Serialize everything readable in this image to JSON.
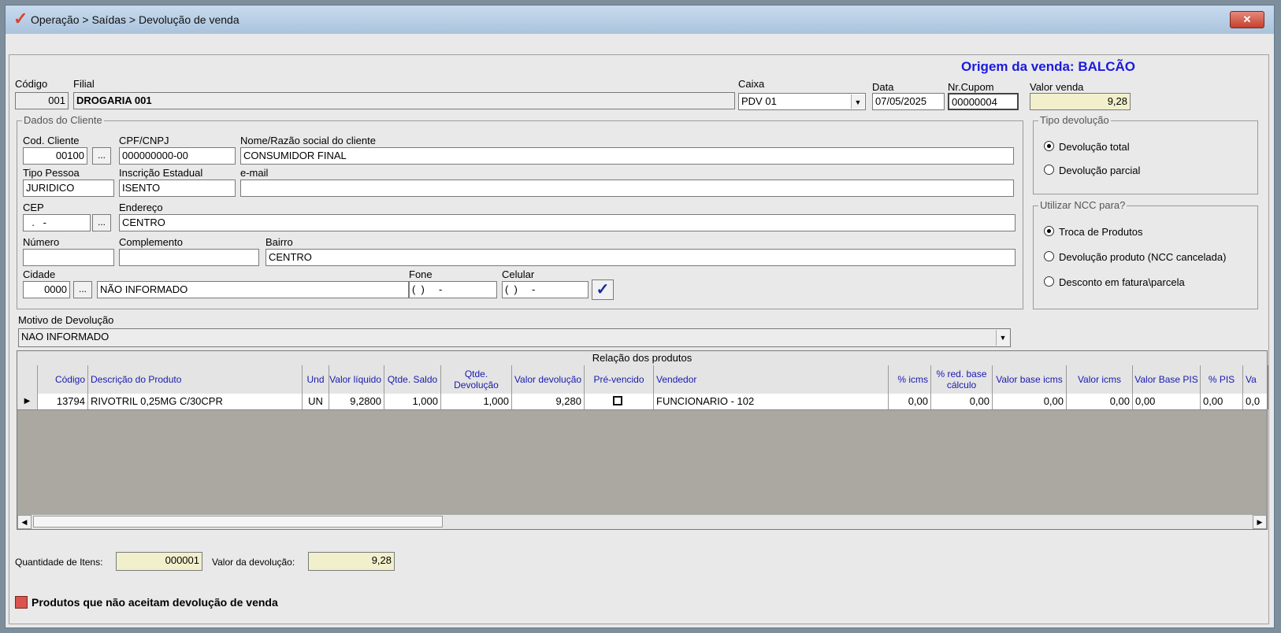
{
  "window": {
    "title": "Operação > Saídas > Devolução de venda",
    "close_label": "✕"
  },
  "origem": "Origem da venda: BALCÃO",
  "header": {
    "codigo_label": "Código",
    "codigo_value": "001",
    "filial_label": "Filial",
    "filial_value": "DROGARIA 001",
    "caixa_label": "Caixa",
    "caixa_value": "PDV 01",
    "data_label": "Data",
    "data_value": "07/05/2025",
    "cupom_label": "Nr.Cupom",
    "cupom_value": "00000004",
    "valor_label": "Valor venda",
    "valor_value": "9,28"
  },
  "cliente": {
    "group_title": "Dados do Cliente",
    "cod_label": "Cod. Cliente",
    "cod_value": "00100",
    "cpf_label": "CPF/CNPJ",
    "cpf_value": "000000000-00",
    "nome_label": "Nome/Razão social do cliente",
    "nome_value": "CONSUMIDOR FINAL",
    "tipo_label": "Tipo Pessoa",
    "tipo_value": "JURIDICO",
    "ie_label": "Inscrição Estadual",
    "ie_value": "ISENTO",
    "email_label": "e-mail",
    "email_value": "",
    "cep_label": "CEP",
    "cep_value": "  .   -",
    "endereco_label": "Endereço",
    "endereco_value": "CENTRO",
    "numero_label": "Número",
    "numero_value": "",
    "complemento_label": "Complemento",
    "complemento_value": "",
    "bairro_label": "Bairro",
    "bairro_value": "CENTRO",
    "cidade_label": "Cidade",
    "cidade_code": "0000",
    "cidade_value": "NÃO INFORMADO",
    "fone_label": "Fone",
    "fone_value": "(  )     -",
    "celular_label": "Celular",
    "celular_value": "(  )     -",
    "lookup_label": "..."
  },
  "tipo_devolucao": {
    "title": "Tipo devolução",
    "options": [
      "Devolução total",
      "Devolução parcial"
    ],
    "selected": 0
  },
  "ncc": {
    "title": "Utilizar NCC para?",
    "options": [
      "Troca de Produtos",
      "Devolução produto (NCC cancelada)",
      "Desconto em fatura\\parcela"
    ],
    "selected": 0
  },
  "motivo": {
    "label": "Motivo de Devolução",
    "value": "NAO INFORMADO"
  },
  "grid": {
    "caption": "Relação dos produtos",
    "columns": [
      "Código",
      "Descrição do Produto",
      "Und",
      "Valor líquido",
      "Qtde. Saldo",
      "Qtde. Devolução",
      "Valor devolução",
      "Pré-vencido",
      "Vendedor",
      "% icms",
      "% red. base cálculo",
      "Valor base icms",
      "Valor icms",
      "Valor Base PIS",
      "% PIS",
      "Va"
    ],
    "rows": [
      [
        "13794",
        "RIVOTRIL 0,25MG C/30CPR",
        "UN",
        "9,2800",
        "1,000",
        "1,000",
        "9,280",
        "",
        "FUNCIONARIO - 102",
        "0,00",
        "0,00",
        "0,00",
        "0,00",
        "0,00",
        "0,00",
        "0,0"
      ]
    ]
  },
  "footer": {
    "qtd_label": "Quantidade de Itens:",
    "qtd_value": "000001",
    "valor_label": "Valor da devolução:",
    "valor_value": "9,28",
    "legend_label": "Produtos que não aceitam devolução de venda"
  },
  "colors": {
    "origem": "#1a1ae0",
    "legend_swatch": "#d9534f",
    "grid_header_text": "#1a1ab0"
  }
}
